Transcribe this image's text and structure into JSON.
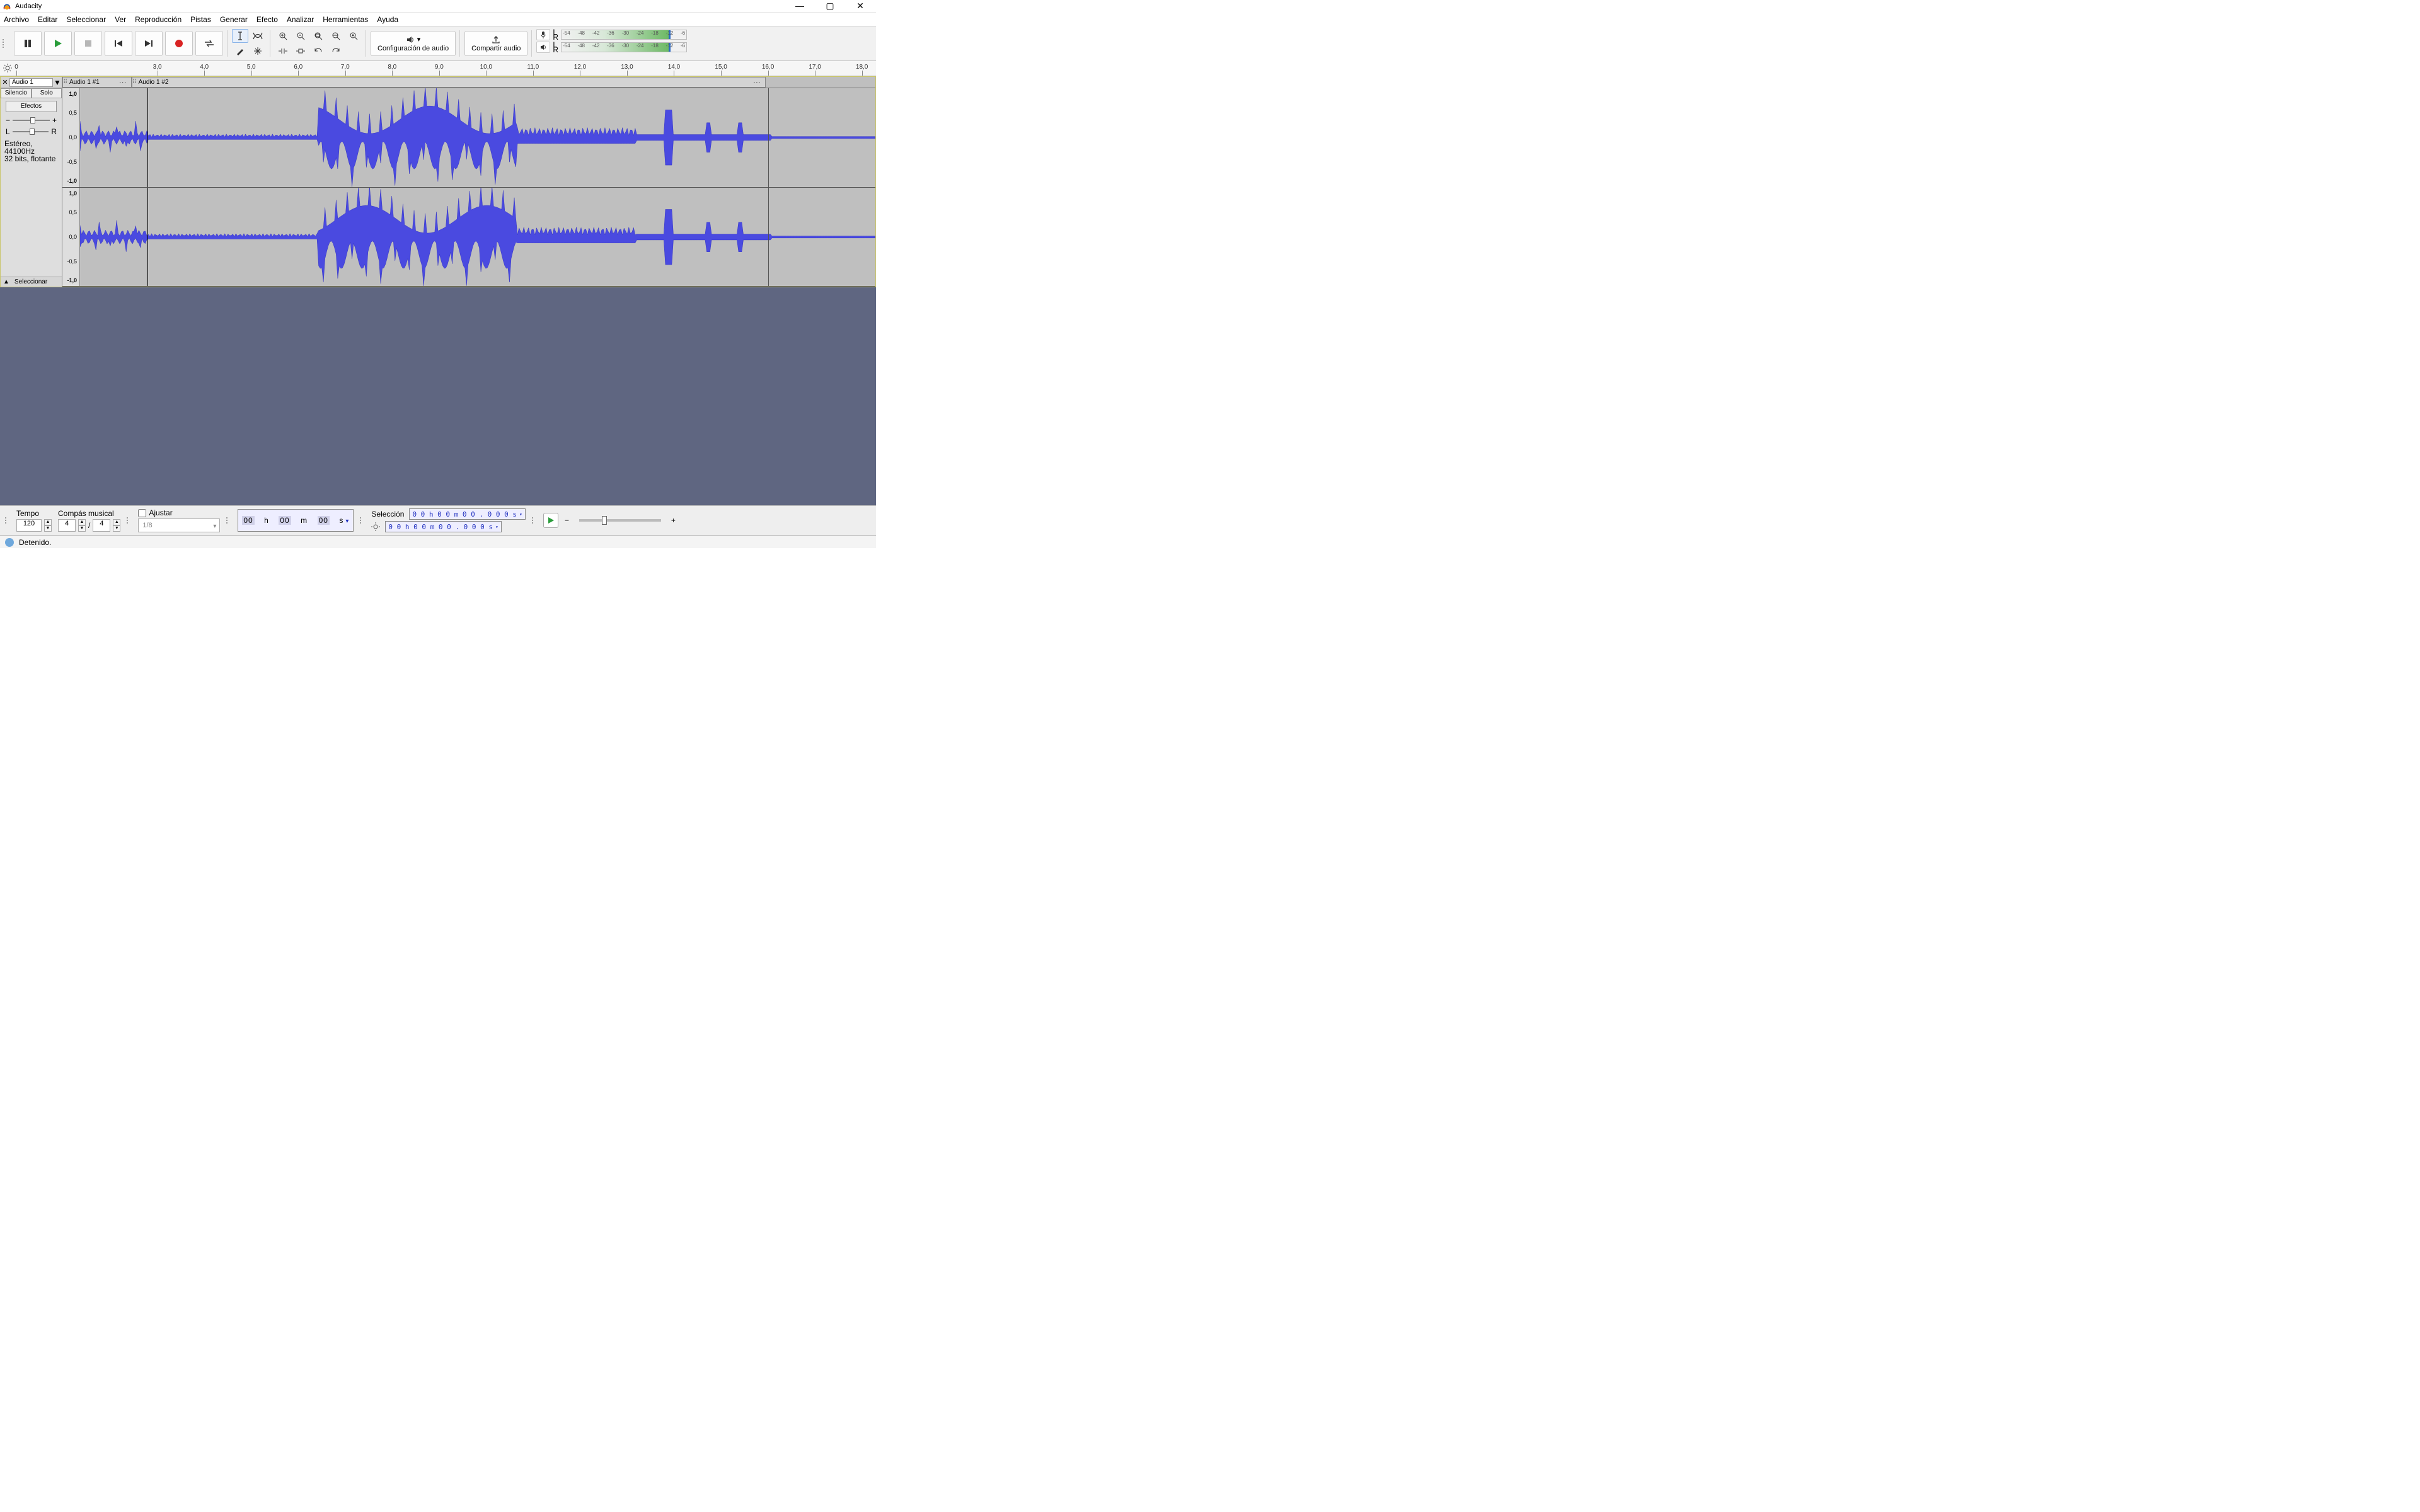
{
  "app": {
    "title": "Audacity"
  },
  "menu": [
    "Archivo",
    "Editar",
    "Seleccionar",
    "Ver",
    "Reproducción",
    "Pistas",
    "Generar",
    "Efecto",
    "Analizar",
    "Herramientas",
    "Ayuda"
  ],
  "toolbar": {
    "audiocfg": "Configuración de audio",
    "share": "Compartir audio"
  },
  "meter": {
    "ticks": [
      "-54",
      "-48",
      "-42",
      "-36",
      "-30",
      "-24",
      "-18",
      "-12",
      "-6"
    ]
  },
  "ruler": {
    "start": 0,
    "step": 1.0,
    "labels": [
      "0",
      "3,0",
      "4,0",
      "5,0",
      "6,0",
      "7,0",
      "8,0",
      "9,0",
      "10,0",
      "11,0",
      "12,0",
      "13,0",
      "14,0",
      "15,0",
      "16,0",
      "17,0",
      "18,0"
    ]
  },
  "track": {
    "name": "Audio 1",
    "silence": "Silencio",
    "solo": "Solo",
    "effects": "Efectos",
    "panL": "L",
    "panR": "R",
    "info1": "Estéreo, 44100Hz",
    "info2": "32 bits, flotante",
    "select": "Seleccionar",
    "clips": [
      {
        "name": "Audio 1 #1",
        "leftPct": 0,
        "widthPct": 8.5
      },
      {
        "name": "Audio 1 #2",
        "leftPct": 8.5,
        "widthPct": 78
      }
    ]
  },
  "vscale": [
    "1,0",
    "0,5",
    "0,0",
    "-0,5",
    "-1,0"
  ],
  "bottom": {
    "tempoLabel": "Tempo",
    "tempo": "120",
    "compasLabel": "Compás musical",
    "beats1": "4",
    "beats2": "4",
    "ajustar": "Ajustar",
    "snap": "1/8",
    "time": {
      "h": "00",
      "hU": "h",
      "m": "00",
      "mU": "m",
      "s": "00",
      "sU": "s"
    },
    "selLabel": "Selección",
    "selTime": "0 0 h 0 0 m 0 0 . 0 0 0 s"
  },
  "status": {
    "text": "Detenido."
  }
}
